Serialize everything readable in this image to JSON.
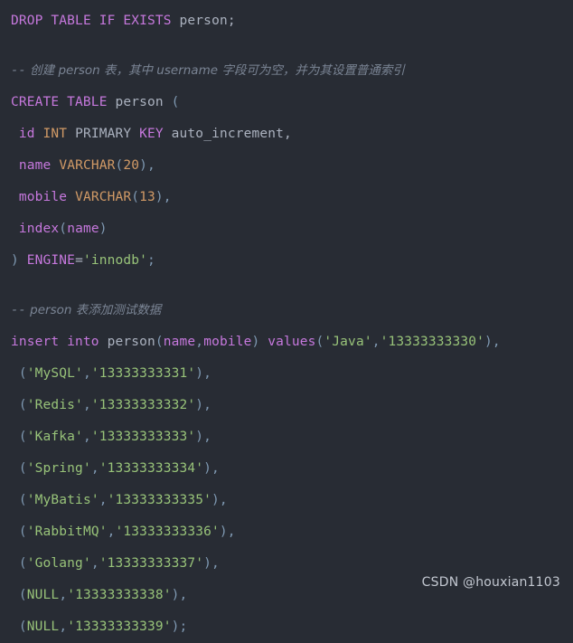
{
  "editor": {
    "background_color": "#282c34",
    "language": "sql",
    "colors": {
      "keyword": "#c678dd",
      "identifier": "#c678dd",
      "type": "#d19a66",
      "number": "#d19a66",
      "string": "#98c379",
      "punctuation": "#7f99b2",
      "comment": "#7a8494",
      "plain": "#abb2bf"
    }
  },
  "code": {
    "line1": {
      "kw_drop": "DROP",
      "kw_table": "TABLE",
      "kw_if": "IF",
      "kw_exists": "EXISTS",
      "target": "person;"
    },
    "comment1": {
      "marker": "--",
      "text": " 创建 person 表，其中 username 字段可为空，并为其设置普通索引"
    },
    "line2": {
      "kw_create": "CREATE",
      "kw_table": "TABLE",
      "name": "person",
      "paren": "("
    },
    "line3": {
      "col": "id",
      "type": "INT",
      "kw_primary": "PRIMARY",
      "kw_key": "KEY",
      "extra": "auto_increment,"
    },
    "line4": {
      "col": "name",
      "type": "VARCHAR",
      "open": "(",
      "len": "20",
      "close": "),"
    },
    "line5": {
      "col": "mobile",
      "type": "VARCHAR",
      "open": "(",
      "len": "13",
      "close": "),"
    },
    "line6": {
      "fn": "index",
      "open": "(",
      "col": "name",
      "close": ")"
    },
    "line7": {
      "close_paren": ")",
      "kw_engine": "ENGINE",
      "eq": "=",
      "value": "'innodb'",
      "semi": ";"
    },
    "comment2": {
      "marker": "--",
      "text": " person 表添加测试数据"
    },
    "insert": {
      "kw_insert": "insert",
      "kw_into": "into",
      "table": "person",
      "open": "(",
      "col1": "name",
      "comma": ",",
      "col2": "mobile",
      "close": ")",
      "kw_values": "values",
      "vopen": "(",
      "v1": "'Java'",
      "vcomma": ",",
      "v2": "'13333333330'",
      "vclose": "),"
    },
    "rows": [
      {
        "open": "(",
        "name": "'MySQL'",
        "comma": ",",
        "mobile": "'13333333331'",
        "close": "),"
      },
      {
        "open": "(",
        "name": "'Redis'",
        "comma": ",",
        "mobile": "'13333333332'",
        "close": "),"
      },
      {
        "open": "(",
        "name": "'Kafka'",
        "comma": ",",
        "mobile": "'13333333333'",
        "close": "),"
      },
      {
        "open": "(",
        "name": "'Spring'",
        "comma": ",",
        "mobile": "'13333333334'",
        "close": "),"
      },
      {
        "open": "(",
        "name": "'MyBatis'",
        "comma": ",",
        "mobile": "'13333333335'",
        "close": "),"
      },
      {
        "open": "(",
        "name": "'RabbitMQ'",
        "comma": ",",
        "mobile": "'13333333336'",
        "close": "),"
      },
      {
        "open": "(",
        "name": "'Golang'",
        "comma": ",",
        "mobile": "'13333333337'",
        "close": "),"
      },
      {
        "open": "(",
        "name": "NULL",
        "comma": ",",
        "mobile": "'13333333338'",
        "close": "),"
      },
      {
        "open": "(",
        "name": "NULL",
        "comma": ",",
        "mobile": "'13333333339'",
        "close": ");"
      }
    ]
  },
  "watermark": {
    "text": "CSDN @houxian1103"
  }
}
